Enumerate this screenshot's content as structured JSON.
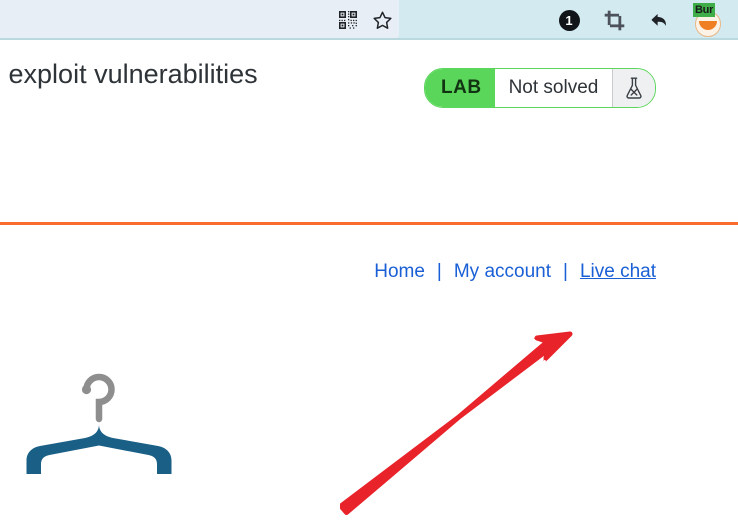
{
  "browser": {
    "toolbar": {
      "qr_icon": "qr-code-icon",
      "bookmark_icon": "star-icon",
      "notification_count": "1",
      "crop_icon": "crop-screenshot-icon",
      "back_icon": "back-arrow-icon",
      "burp_extension_label": "Bur"
    }
  },
  "lab": {
    "title": "o exploit vulnerabilities",
    "badge_label": "LAB",
    "status_text": "Not solved",
    "flask_icon": "flask-not-solved-icon",
    "badge_color": "#5ad65a",
    "rule_color": "#f96c2e"
  },
  "nav": {
    "items": [
      {
        "label": "Home",
        "hovered": false
      },
      {
        "label": "My account",
        "hovered": false
      },
      {
        "label": "Live chat",
        "hovered": true
      }
    ],
    "separator": "|",
    "link_color": "#1a5fd6"
  },
  "logo": {
    "name": "clothes-hanger-logo",
    "hook_color": "#8e8e8e",
    "body_color": "#1a5f86"
  },
  "annotation": {
    "name": "red-pointer-arrow",
    "color": "#e8232a",
    "points_at": "Live chat"
  }
}
